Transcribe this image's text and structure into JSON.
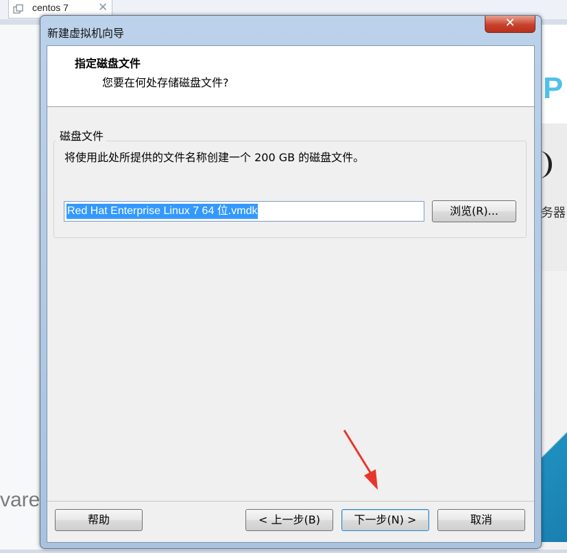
{
  "background": {
    "tab_label": "centos  7",
    "tab_close": "✕",
    "right_letter": "P",
    "right_text": "务器",
    "left_brand": "vare"
  },
  "dialog": {
    "title": "新建虚拟机向导",
    "close": "✕",
    "header_title": "指定磁盘文件",
    "header_subtitle": "您要在何处存储磁盘文件?",
    "group_label": "磁盘文件",
    "group_description": "将使用此处所提供的文件名称创建一个 200 GB 的磁盘文件。",
    "file_path": "Red Hat Enterprise Linux 7 64 位.vmdk",
    "browse_label": "浏览(R)...",
    "buttons": {
      "help": "帮助",
      "back": "< 上一步(B)",
      "next": "下一步(N) >",
      "cancel": "取消"
    }
  },
  "colors": {
    "annotation_arrow": "#e8352c",
    "selection": "#3399ff",
    "close_button": "#c8412c"
  }
}
